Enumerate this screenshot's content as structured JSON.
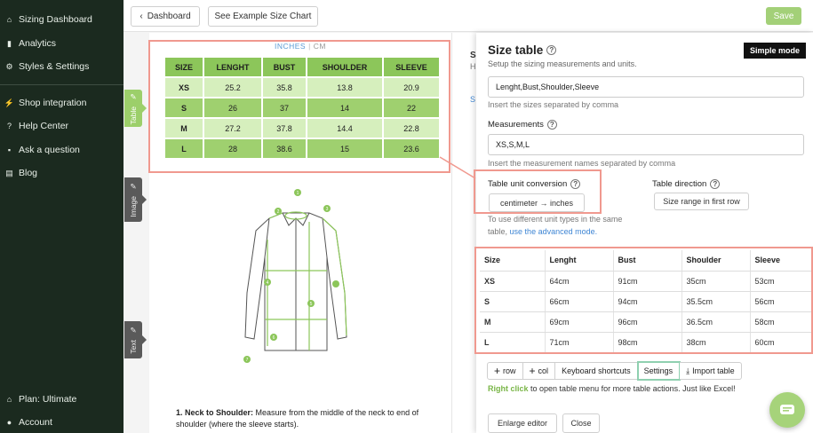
{
  "sidebar": {
    "items_top": [
      {
        "label": "Sizing Dashboard",
        "icon": "home-icon"
      },
      {
        "label": "Analytics",
        "icon": "bar-chart-icon"
      },
      {
        "label": "Styles & Settings",
        "icon": "gear-icon"
      }
    ],
    "items_mid": [
      {
        "label": "Shop integration",
        "icon": "lightning-icon"
      },
      {
        "label": "Help Center",
        "icon": "question-icon"
      },
      {
        "label": "Ask a question",
        "icon": "chat-bubble-icon"
      },
      {
        "label": "Blog",
        "icon": "blog-icon"
      }
    ],
    "items_bottom": [
      {
        "label": "Plan: Ultimate",
        "icon": "home-icon"
      },
      {
        "label": "Account",
        "icon": "person-icon"
      }
    ]
  },
  "side_tabs": [
    {
      "label": "Table",
      "active": true
    },
    {
      "label": "Image",
      "active": false
    },
    {
      "label": "Text",
      "active": false
    }
  ],
  "topbar": {
    "back_label": "Dashboard",
    "example_label": "See Example Size Chart",
    "save_label": "Save"
  },
  "preview": {
    "unit_active": "INCHES",
    "unit_inactive": "CM",
    "headers": [
      "SIZE",
      "LENGHT",
      "BUST",
      "SHOULDER",
      "SLEEVE"
    ],
    "rows": [
      [
        "XS",
        "25.2",
        "35.8",
        "13.8",
        "20.9"
      ],
      [
        "S",
        "26",
        "37",
        "14",
        "22"
      ],
      [
        "M",
        "27.2",
        "37.8",
        "14.4",
        "22.8"
      ],
      [
        "L",
        "28",
        "38.6",
        "15",
        "23.6"
      ]
    ],
    "instruction_title": "1. Neck to Shoulder:",
    "instruction_text": "Measure from the middle of the neck to end of shoulder (where the sleeve starts).",
    "shirt_markers": [
      "1",
      "2",
      "3",
      "4",
      "5",
      "6",
      "7"
    ]
  },
  "mid_panel": {
    "letter_s": "S",
    "letter_h": "H",
    "letter_s2": "S"
  },
  "panel": {
    "title": "Size table",
    "subtitle": "Setup the sizing measurements and units.",
    "mode_label": "Simple mode",
    "sizes_value": "Lenght,Bust,Shoulder,Sleeve",
    "sizes_hint": "Insert the sizes separated by comma",
    "measurements_label": "Measurements",
    "measurements_value": "XS,S,M,L",
    "measurements_hint": "Insert the measurement names separated by comma",
    "unit_conversion_label": "Table unit conversion",
    "unit_conversion_value": "centimeter → inches",
    "direction_label": "Table direction",
    "direction_value": "Size range in first row",
    "unit_note_1": "To use different unit types in the same",
    "unit_note_2": "table,",
    "unit_note_link": "use the advanced mode.",
    "table_headers": [
      "Size",
      "Lenght",
      "Bust",
      "Shoulder",
      "Sleeve"
    ],
    "table_rows": [
      [
        "XS",
        "64cm",
        "91cm",
        "35cm",
        "53cm"
      ],
      [
        "S",
        "66cm",
        "94cm",
        "35.5cm",
        "56cm"
      ],
      [
        "M",
        "69cm",
        "96cm",
        "36.5cm",
        "58cm"
      ],
      [
        "L",
        "71cm",
        "98cm",
        "38cm",
        "60cm"
      ]
    ],
    "toolbar": {
      "row": "row",
      "col": "col",
      "shortcuts": "Keyboard shortcuts",
      "settings": "Settings",
      "import": "Import table"
    },
    "tip_green": "Right click",
    "tip_text": "to open table menu for more table actions. Just like Excel!",
    "enlarge_label": "Enlarge editor",
    "close_label": "Close"
  },
  "colors": {
    "sidebar_bg": "#1b2a1f",
    "accent_green": "#8cc65a",
    "highlight_red": "#f0998f",
    "link_blue": "#3f86d4"
  }
}
